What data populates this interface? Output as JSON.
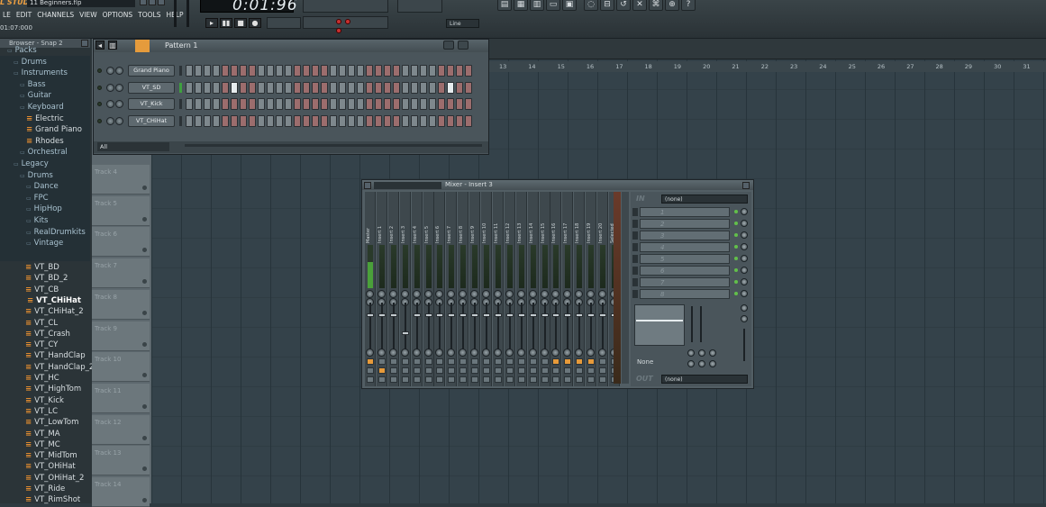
{
  "app": {
    "brand": "L STUDIO",
    "project": "11 Beginners.flp"
  },
  "menu": [
    "LE",
    "EDIT",
    "CHANNELS",
    "VIEW",
    "OPTIONS",
    "TOOLS",
    "HELP"
  ],
  "clock": {
    "song_time": "01:07:000",
    "lcd": "0:01:96",
    "mode": "Line"
  },
  "browser": {
    "title": "Browser - Snap 2",
    "items": [
      "Packs",
      "Drums",
      "Instruments",
      "Bass",
      "Guitar",
      "Keyboard",
      "Electric",
      "Grand Piano",
      "Rhodes",
      "Orchestral",
      "Legacy",
      "Drums",
      "Dance",
      "FPC",
      "HipHop",
      "Kits",
      "RealDrumkits",
      "Vintage"
    ],
    "files": [
      "VT_BD",
      "VT_BD_2",
      "VT_CB",
      "VT_CHiHat",
      "VT_CHiHat_2",
      "VT_CL",
      "VT_Crash",
      "VT_CY",
      "VT_HandClap",
      "VT_HandClap_2",
      "VT_HC",
      "VT_HighTom",
      "VT_Kick",
      "VT_LC",
      "VT_LowTom",
      "VT_MA",
      "VT_MC",
      "VT_MidTom",
      "VT_OHiHat",
      "VT_OHiHat_2",
      "VT_Ride",
      "VT_RimShot"
    ]
  },
  "tracks": [
    "Track 4",
    "Track 5",
    "Track 6",
    "Track 7",
    "Track 8",
    "Track 9",
    "Track 10",
    "Track 11",
    "Track 12",
    "Track 13",
    "Track 14"
  ],
  "ruler": [
    "13",
    "14",
    "15",
    "16",
    "17",
    "18",
    "19",
    "20",
    "21",
    "22",
    "23",
    "24",
    "25",
    "26",
    "27",
    "28",
    "29",
    "30",
    "31"
  ],
  "step_sequencer": {
    "pattern": "Pattern 1",
    "filter": "All",
    "channels": [
      {
        "name": "Grand Piano",
        "steps": []
      },
      {
        "name": "VT_SD",
        "steps": [
          5,
          29
        ]
      },
      {
        "name": "VT_Kick",
        "steps": []
      },
      {
        "name": "VT_CHiHat",
        "steps": []
      }
    ]
  },
  "mixer": {
    "title": "Mixer - Insert 3",
    "strips": [
      "Master",
      "Insert 1",
      "Insert 2",
      "Insert 3",
      "Insert 4",
      "Insert 5",
      "Insert 6",
      "Insert 7",
      "Insert 8",
      "Insert 9",
      "Insert 10",
      "Insert 11",
      "Insert 12",
      "Insert 13",
      "Insert 14",
      "Insert 15",
      "Insert 16",
      "Insert 17",
      "Insert 18",
      "Insert 19",
      "Insert 20",
      "Selected"
    ],
    "in_label": "IN",
    "out_label": "OUT",
    "in_select": "(none)",
    "out_select": "(none)",
    "slots": [
      "1",
      "2",
      "3",
      "4",
      "5",
      "6",
      "7",
      "8"
    ],
    "eq_none": "None"
  }
}
